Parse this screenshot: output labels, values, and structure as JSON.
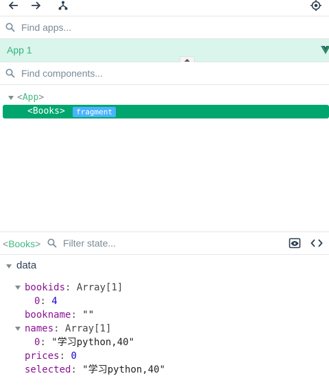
{
  "toolbar": {
    "back_icon": "arrow-left-icon",
    "forward_icon": "arrow-right-icon",
    "tree_icon": "git-branch-icon",
    "target_icon": "crosshair-icon"
  },
  "apps": {
    "search_placeholder": "Find apps...",
    "selected_app": "App 1"
  },
  "components": {
    "search_placeholder": "Find components...",
    "tree": [
      {
        "name": "App"
      },
      {
        "name": "Books",
        "badge": "fragment"
      }
    ]
  },
  "state": {
    "component_name": "Books",
    "filter_placeholder": "Filter state...",
    "section": "data",
    "props": {
      "bookids": {
        "key": "bookids",
        "value": "Array[1]",
        "child_index": "0",
        "child_value": "4"
      },
      "bookname": {
        "key": "bookname",
        "value": "\"\""
      },
      "names": {
        "key": "names",
        "value": "Array[1]",
        "child_index": "0",
        "child_value": "\"学习python,40\""
      },
      "prices": {
        "key": "prices",
        "value": "0"
      },
      "selected": {
        "key": "selected",
        "value": "\"学习python,40\""
      }
    }
  },
  "colors": {
    "accent": "#42b983",
    "selected_row": "#00a66e",
    "badge": "#4ab3ff",
    "app_row_bg": "#d9f5ec",
    "key": "#881391",
    "number": "#1c00cf"
  }
}
